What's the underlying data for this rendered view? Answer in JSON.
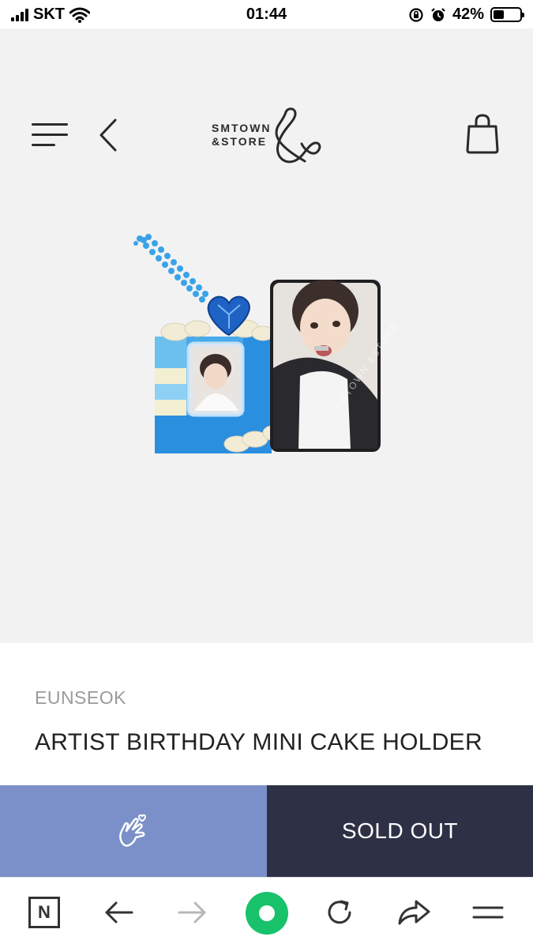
{
  "status_bar": {
    "carrier": "SKT",
    "time": "01:44",
    "battery_percent": "42%",
    "battery_level": 0.42
  },
  "header": {
    "logo_line1": "SMTOWN",
    "logo_line2": "&STORE",
    "icons": [
      "menu-icon",
      "back-arrow-icon",
      "shopping-bag-icon"
    ]
  },
  "product": {
    "artist": "EUNSEOK",
    "title": "ARTIST BIRTHDAY MINI CAKE HOLDER",
    "photocard_watermark": "SMTOWN &STORE"
  },
  "actions": {
    "wish_icon": "finger-heart-icon",
    "soldout_label": "SOLD OUT"
  },
  "browser_toolbar": {
    "home_label": "N",
    "icons": [
      "naver-home-icon",
      "back-arrow-icon",
      "forward-arrow-icon",
      "green-dot-icon",
      "refresh-icon",
      "share-icon",
      "menu-icon"
    ]
  },
  "colors": {
    "wish_button": "#7b8fc8",
    "soldout_button": "#2e3146",
    "cake_blue": "#2b8fe0",
    "green_button": "#18c26b"
  }
}
